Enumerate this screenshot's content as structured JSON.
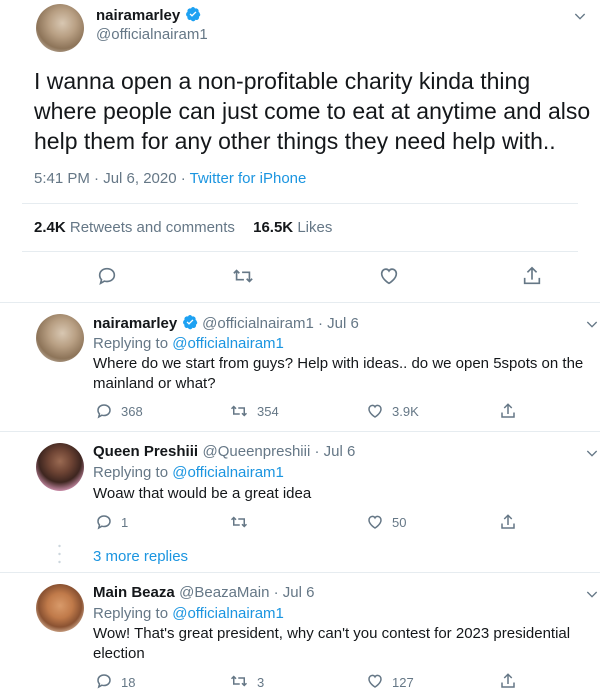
{
  "main_tweet": {
    "display_name": "nairamarley",
    "handle": "@officialnairam1",
    "text_line1": "I wanna open a non-profitable charity kinda thing",
    "text_line2": "where people can just come to eat at anytime and also",
    "text_line3": "help them for any other things they need help with..",
    "timestamp": "5:41 PM · Jul 6, 2020 · ",
    "source": "Twitter for iPhone",
    "retweets_count": "2.4K",
    "retweets_label": "Retweets and comments",
    "likes_count": "16.5K",
    "likes_label": "Likes"
  },
  "replies": [
    {
      "display_name": "nairamarley",
      "handle": "@officialnairam1 · Jul 6",
      "replying_to_label": "Replying to",
      "replying_to": "@officialnairam1",
      "text_line1": "Where do we start from guys? Help with ideas.. do we open 5spots on the",
      "text_line2": "mainland or what?",
      "comments": "368",
      "retweets": "354",
      "likes": "3.9K"
    },
    {
      "display_name": "Queen Preshiii",
      "handle": "@Queenpreshiii · Jul 6",
      "replying_to_label": "Replying to",
      "replying_to": "@officialnairam1",
      "text_line1": "Woaw that would be a great idea",
      "comments": "1",
      "retweets": "",
      "likes": "50"
    },
    {
      "display_name": "Main Beaza",
      "handle": "@BeazaMain · Jul 6",
      "replying_to_label": "Replying to",
      "replying_to": "@officialnairam1",
      "text_line1": "Wow! That's great president, why can't you contest for 2023 presidential",
      "text_line2": "election",
      "comments": "18",
      "retweets": "3",
      "likes": "127"
    }
  ],
  "more_replies": "3 more replies",
  "colors": {
    "accent": "#1b95e0",
    "text": "#14171a",
    "muted": "#657786",
    "divider": "#e6ecf0"
  }
}
